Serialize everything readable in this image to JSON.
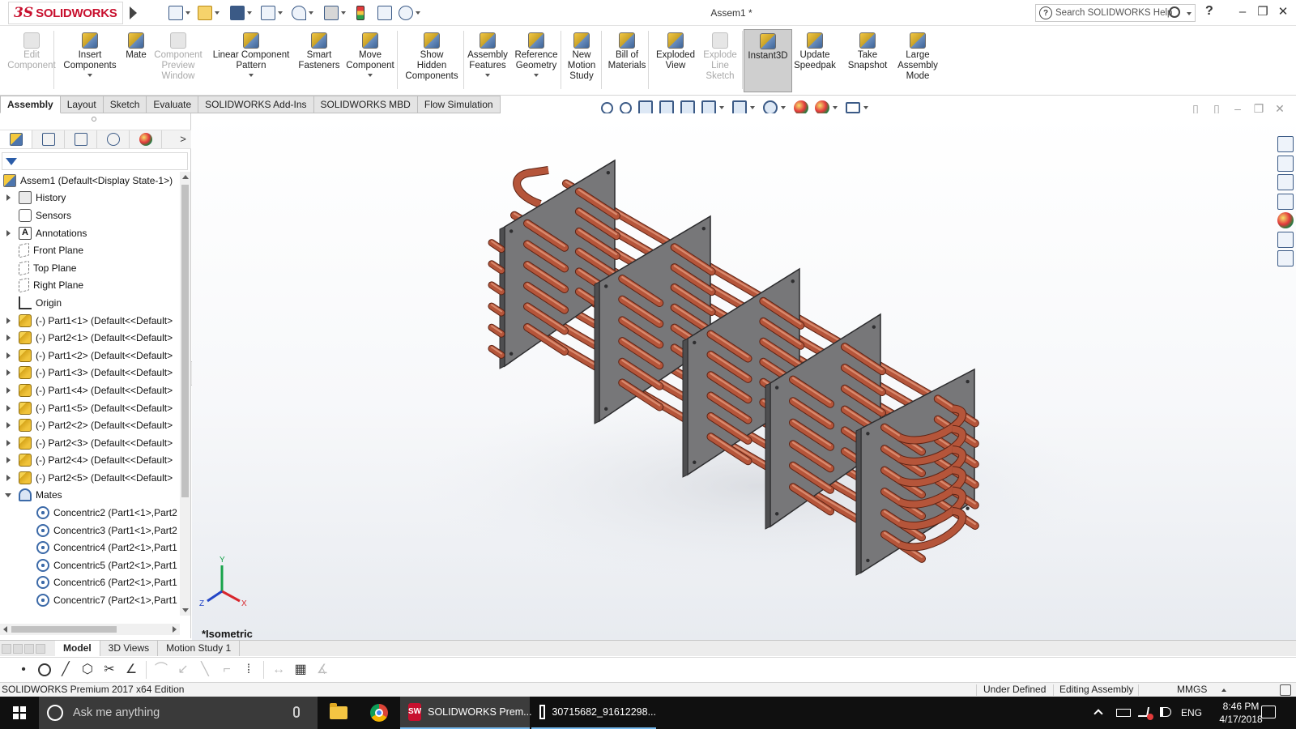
{
  "app": {
    "logo_prefix": "3S",
    "logo_text": "SOLIDWORKS",
    "document_title": "Assem1 *",
    "search_placeholder": "Search SOLIDWORKS Help",
    "help_label": "?",
    "minimize": "–",
    "restore": "❐",
    "close": "✕"
  },
  "command_manager": {
    "buttons": [
      {
        "label": "Edit\nComponent",
        "enabled": false
      },
      {
        "label": "Insert\nComponents",
        "enabled": true
      },
      {
        "label": "Mate",
        "enabled": true
      },
      {
        "label": "Component\nPreview\nWindow",
        "enabled": false
      },
      {
        "label": "Linear Component\nPattern",
        "enabled": true
      },
      {
        "label": "Smart\nFasteners",
        "enabled": true
      },
      {
        "label": "Move\nComponent",
        "enabled": true
      },
      {
        "label": "Show\nHidden\nComponents",
        "enabled": true
      },
      {
        "label": "Assembly\nFeatures",
        "enabled": true
      },
      {
        "label": "Reference\nGeometry",
        "enabled": true
      },
      {
        "label": "New\nMotion\nStudy",
        "enabled": true
      },
      {
        "label": "Bill of\nMaterials",
        "enabled": true
      },
      {
        "label": "Exploded\nView",
        "enabled": true
      },
      {
        "label": "Explode\nLine\nSketch",
        "enabled": false
      },
      {
        "label": "Instant3D",
        "enabled": true,
        "active": true
      },
      {
        "label": "Update\nSpeedpak",
        "enabled": true
      },
      {
        "label": "Take\nSnapshot",
        "enabled": true
      },
      {
        "label": "Large\nAssembly\nMode",
        "enabled": true
      }
    ]
  },
  "tabs": [
    "Assembly",
    "Layout",
    "Sketch",
    "Evaluate",
    "SOLIDWORKS Add-Ins",
    "SOLIDWORKS MBD",
    "Flow Simulation"
  ],
  "active_tab": "Assembly",
  "feature_tree": {
    "root": "Assem1  (Default<Display State-1>)",
    "items": [
      {
        "label": "History",
        "icon": "history-icon",
        "expandable": true
      },
      {
        "label": "Sensors",
        "icon": "sensors-icon",
        "expandable": false
      },
      {
        "label": "Annotations",
        "icon": "annotations-icon",
        "expandable": true
      },
      {
        "label": "Front Plane",
        "icon": "plane-icon",
        "expandable": false
      },
      {
        "label": "Top Plane",
        "icon": "plane-icon",
        "expandable": false
      },
      {
        "label": "Right Plane",
        "icon": "plane-icon",
        "expandable": false
      },
      {
        "label": "Origin",
        "icon": "origin-icon",
        "expandable": false
      },
      {
        "label": "(-) Part1<1> (Default<<Default>",
        "icon": "part-icon",
        "expandable": true
      },
      {
        "label": "(-) Part2<1> (Default<<Default>",
        "icon": "part-icon",
        "expandable": true
      },
      {
        "label": "(-) Part1<2> (Default<<Default>",
        "icon": "part-icon",
        "expandable": true
      },
      {
        "label": "(-) Part1<3> (Default<<Default>",
        "icon": "part-icon",
        "expandable": true
      },
      {
        "label": "(-) Part1<4> (Default<<Default>",
        "icon": "part-icon",
        "expandable": true
      },
      {
        "label": "(-) Part1<5> (Default<<Default>",
        "icon": "part-icon",
        "expandable": true
      },
      {
        "label": "(-) Part2<2> (Default<<Default>",
        "icon": "part-icon",
        "expandable": true
      },
      {
        "label": "(-) Part2<3> (Default<<Default>",
        "icon": "part-icon",
        "expandable": true
      },
      {
        "label": "(-) Part2<4> (Default<<Default>",
        "icon": "part-icon",
        "expandable": true
      },
      {
        "label": "(-) Part2<5> (Default<<Default>",
        "icon": "part-icon",
        "expandable": true
      },
      {
        "label": "Mates",
        "icon": "mates-icon",
        "expandable": true,
        "open": true
      }
    ],
    "mates": [
      "Concentric2 (Part1<1>,Part2",
      "Concentric3 (Part1<1>,Part2",
      "Concentric4 (Part2<1>,Part1",
      "Concentric5 (Part2<1>,Part1",
      "Concentric6 (Part2<1>,Part1",
      "Concentric7 (Part2<1>,Part1"
    ]
  },
  "viewport": {
    "view_name": "*Isometric",
    "triad": {
      "x": "X",
      "y": "Y",
      "z": "Z"
    },
    "plate_color": "#777779",
    "tube_color": "#b5553a"
  },
  "bottom_tabs": [
    "Model",
    "3D Views",
    "Motion Study 1"
  ],
  "active_bottom_tab": "Model",
  "status_bar": {
    "edition": "SOLIDWORKS Premium 2017 x64 Edition",
    "definition": "Under Defined",
    "mode": "Editing Assembly",
    "units": "MMGS"
  },
  "taskbar": {
    "search_placeholder": "Ask me anything",
    "apps": [
      {
        "label": "SOLIDWORKS Prem...",
        "icon": "solidworks-icon"
      },
      {
        "label": "30715682_91612298...",
        "icon": "image-viewer-icon"
      }
    ],
    "sw_badge": "SW",
    "language": "ENG",
    "time": "8:46 PM",
    "date": "4/17/2018"
  }
}
